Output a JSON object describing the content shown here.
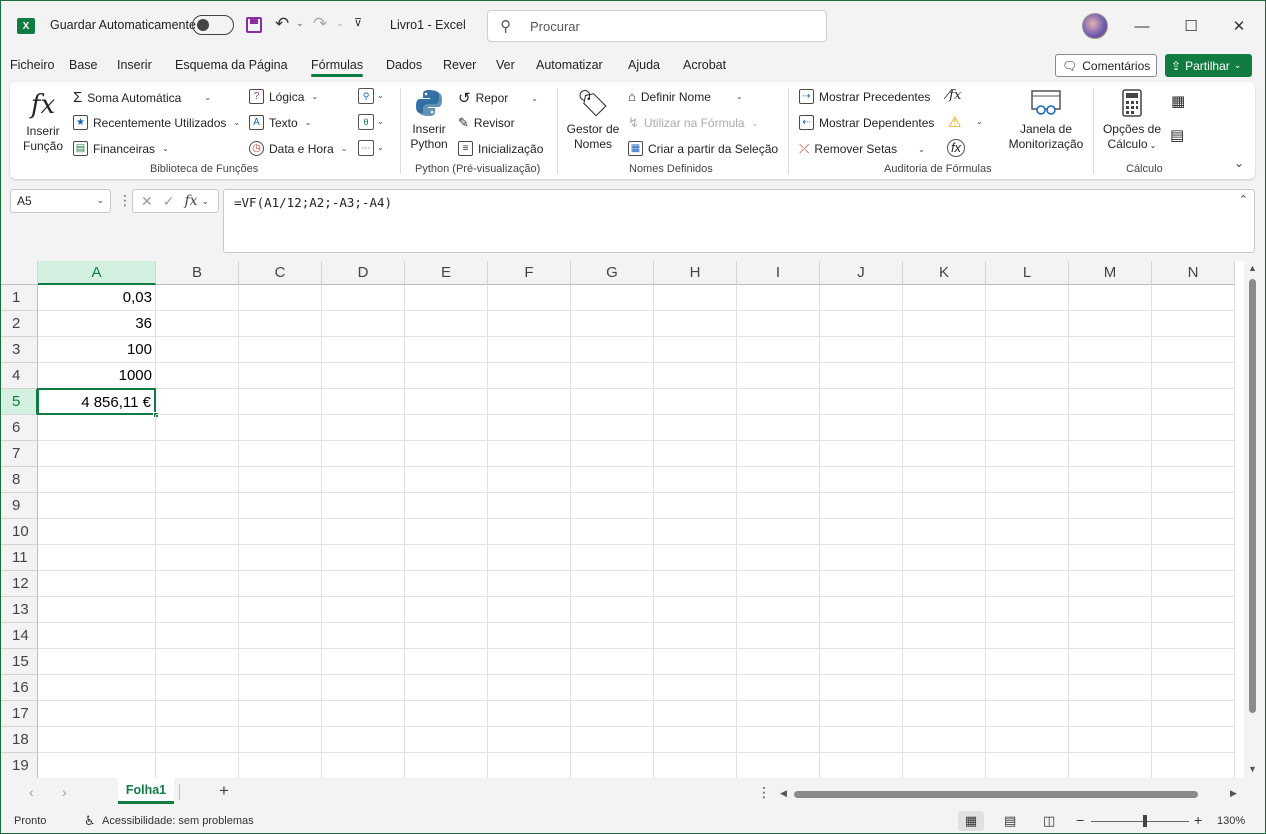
{
  "titlebar": {
    "autosave_label": "Guardar Automaticamente",
    "doc_title": "Livro1  -  Excel",
    "search_placeholder": "Procurar",
    "logo_letter": "X"
  },
  "tabs": [
    "Ficheiro",
    "Base",
    "Inserir",
    "Esquema da Página",
    "Fórmulas",
    "Dados",
    "Rever",
    "Ver",
    "Automatizar",
    "Ajuda",
    "Acrobat"
  ],
  "active_tab": "Fórmulas",
  "header_buttons": {
    "comments": "Comentários",
    "share": "Partilhar"
  },
  "ribbon": {
    "biblioteca": {
      "label": "Biblioteca de Funções",
      "inserir_funcao": [
        "Inserir",
        "Função"
      ],
      "soma": "Soma Automática",
      "recentes": "Recentemente Utilizados",
      "financeiras": "Financeiras",
      "logica": "Lógica",
      "texto": "Texto",
      "data_hora": "Data e Hora"
    },
    "python": {
      "label": "Python (Pré-visualização)",
      "inserir_python": [
        "Inserir",
        "Python"
      ],
      "repor": "Repor",
      "revisor": "Revisor",
      "inicializacao": "Inicialização"
    },
    "nomes": {
      "label": "Nomes Definidos",
      "gestor": [
        "Gestor de",
        "Nomes"
      ],
      "definir": "Definir Nome",
      "utilizar": "Utilizar na Fórmula",
      "criar": "Criar a partir da Seleção"
    },
    "auditoria": {
      "label": "Auditoria de Fórmulas",
      "precedentes": "Mostrar Precedentes",
      "dependentes": "Mostrar Dependentes",
      "remover": "Remover Setas",
      "janela": [
        "Janela de",
        "Monitorização"
      ]
    },
    "calculo": {
      "label": "Cálculo",
      "opcoes": [
        "Opções de",
        "Cálculo"
      ]
    }
  },
  "formula_bar": {
    "name_box": "A5",
    "formula": "=VF(A1/12;A2;-A3;-A4)",
    "fx": "fx"
  },
  "grid": {
    "columns": [
      "A",
      "B",
      "C",
      "D",
      "E",
      "F",
      "G",
      "H",
      "I",
      "J",
      "K",
      "L",
      "M",
      "N"
    ],
    "rows": [
      "1",
      "2",
      "3",
      "4",
      "5",
      "6",
      "7",
      "8",
      "9",
      "10",
      "11",
      "12",
      "13",
      "14",
      "15",
      "16",
      "17",
      "18",
      "19"
    ],
    "cells": {
      "A1": "0,03",
      "A2": "36",
      "A3": "100",
      "A4": "1000",
      "A5": "4 856,11 €"
    }
  },
  "sheets": [
    "Folha1"
  ],
  "status": {
    "ready": "Pronto",
    "accessibility": "Acessibilidade: sem problemas",
    "zoom": "130%"
  },
  "colors": {
    "accent": "#107c41"
  }
}
